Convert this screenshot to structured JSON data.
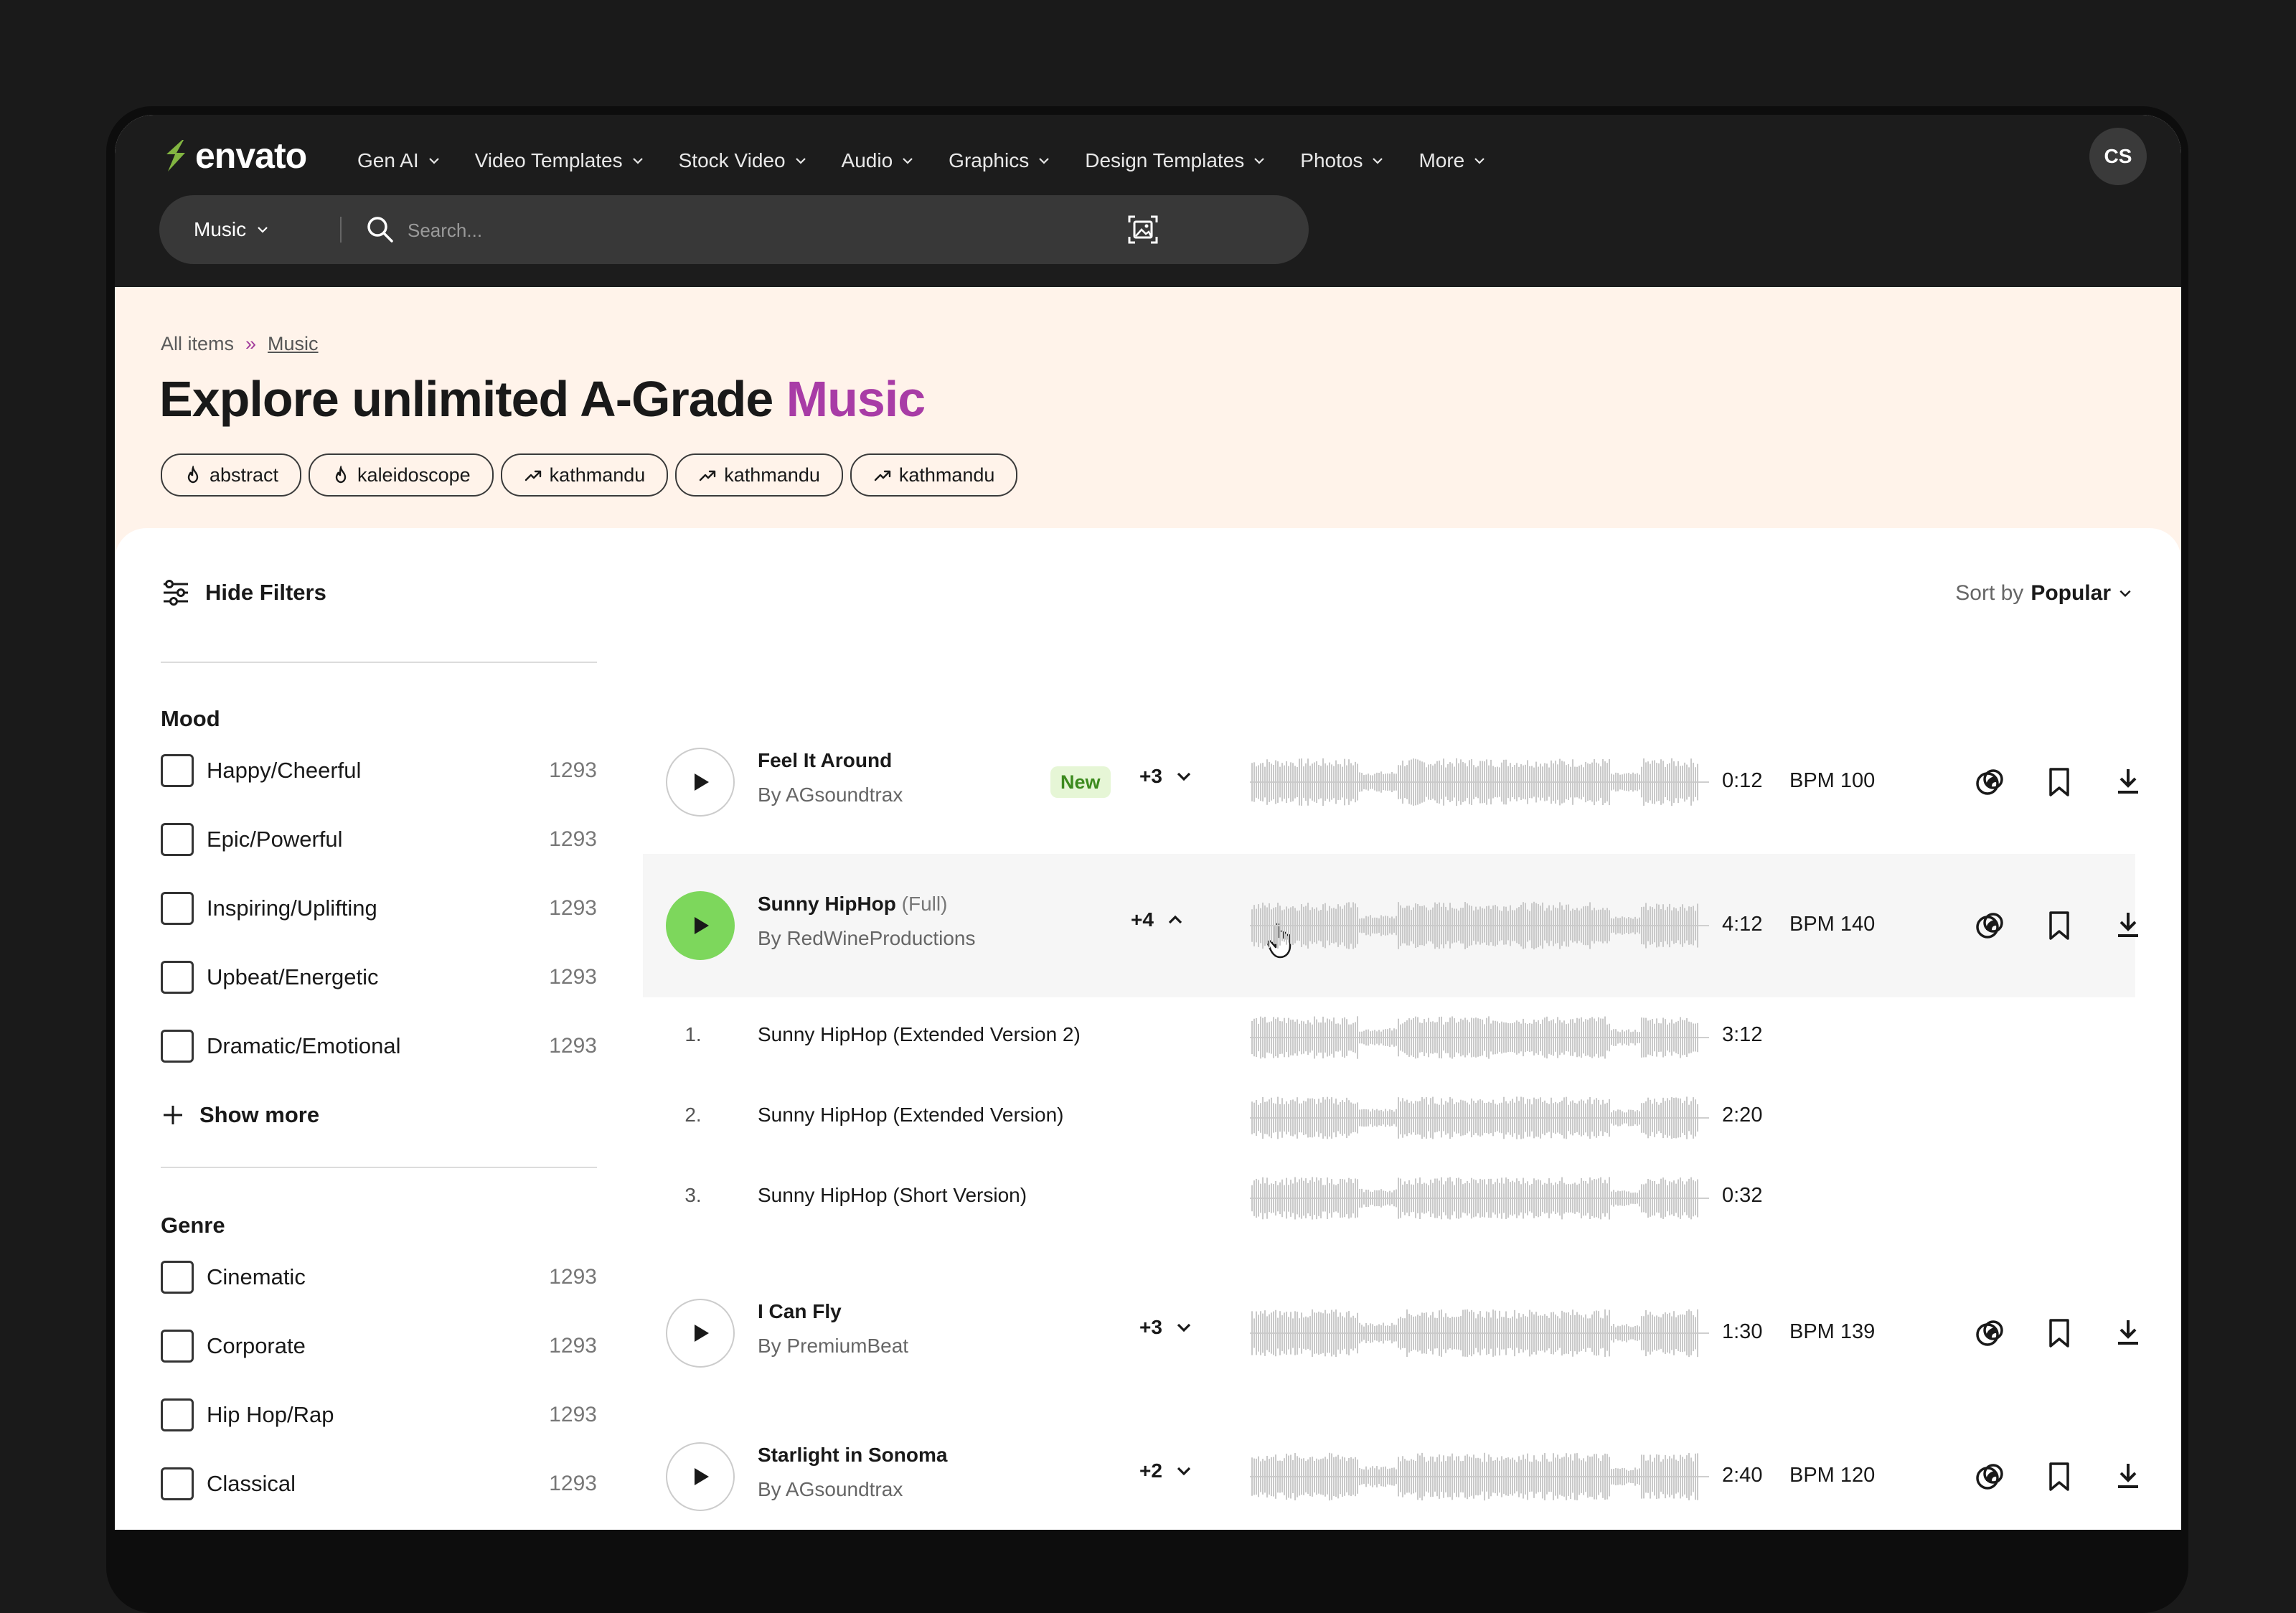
{
  "brand": {
    "name": "envato",
    "accent": "#82b541"
  },
  "nav": [
    {
      "label": "Gen AI"
    },
    {
      "label": "Video Templates"
    },
    {
      "label": "Stock Video"
    },
    {
      "label": "Audio"
    },
    {
      "label": "Graphics"
    },
    {
      "label": "Design Templates"
    },
    {
      "label": "Photos"
    },
    {
      "label": "More"
    }
  ],
  "user": {
    "initials": "CS"
  },
  "search": {
    "category": "Music",
    "placeholder": "Search..."
  },
  "breadcrumb": {
    "root": "All items",
    "separator": "»",
    "current": "Music"
  },
  "hero": {
    "title": "Explore unlimited A-Grade ",
    "accent": "Music",
    "accent_color": "#a83ca6",
    "background": "#fff3ea"
  },
  "chips": [
    {
      "label": "abstract",
      "icon": "flame-icon"
    },
    {
      "label": "kaleidoscope",
      "icon": "flame-icon"
    },
    {
      "label": "kathmandu",
      "icon": "trending-icon"
    },
    {
      "label": "kathmandu",
      "icon": "trending-icon"
    },
    {
      "label": "kathmandu",
      "icon": "trending-icon"
    }
  ],
  "filters": {
    "toggle_label": "Hide Filters",
    "show_more": "Show more",
    "mood": {
      "title": "Mood",
      "items": [
        {
          "label": "Happy/Cheerful",
          "count": "1293"
        },
        {
          "label": "Epic/Powerful",
          "count": "1293"
        },
        {
          "label": "Inspiring/Uplifting",
          "count": "1293"
        },
        {
          "label": "Upbeat/Energetic",
          "count": "1293"
        },
        {
          "label": "Dramatic/Emotional",
          "count": "1293"
        }
      ]
    },
    "genre": {
      "title": "Genre",
      "items": [
        {
          "label": "Cinematic",
          "count": "1293"
        },
        {
          "label": "Corporate",
          "count": "1293"
        },
        {
          "label": "Hip Hop/Rap",
          "count": "1293"
        },
        {
          "label": "Classical",
          "count": "1293"
        }
      ]
    }
  },
  "sort": {
    "prefix": "Sort by",
    "value": "Popular"
  },
  "tracks": [
    {
      "title": "Feel It Around",
      "subtitle": "",
      "author": "By AGsoundtrax",
      "badge": "New",
      "versions": "+3",
      "duration": "0:12",
      "bpm": "BPM 100",
      "expanded": false
    },
    {
      "title": "Sunny HipHop",
      "subtitle": "(Full)",
      "author": "By RedWineProductions",
      "badge": "",
      "versions": "+4",
      "duration": "4:12",
      "bpm": "BPM 140",
      "expanded": true,
      "sub_versions": [
        {
          "num": "1.",
          "title": "Sunny HipHop (Extended Version 2)",
          "duration": "3:12"
        },
        {
          "num": "2.",
          "title": "Sunny HipHop (Extended Version)",
          "duration": "2:20"
        },
        {
          "num": "3.",
          "title": "Sunny HipHop (Short Version)",
          "duration": "0:32"
        }
      ]
    },
    {
      "title": "I Can Fly",
      "subtitle": "",
      "author": "By PremiumBeat",
      "badge": "",
      "versions": "+3",
      "duration": "1:30",
      "bpm": "BPM 139",
      "expanded": false
    },
    {
      "title": "Starlight in Sonoma",
      "subtitle": "",
      "author": "By AGsoundtrax",
      "badge": "",
      "versions": "+2",
      "duration": "2:40",
      "bpm": "BPM 120",
      "expanded": false
    }
  ]
}
